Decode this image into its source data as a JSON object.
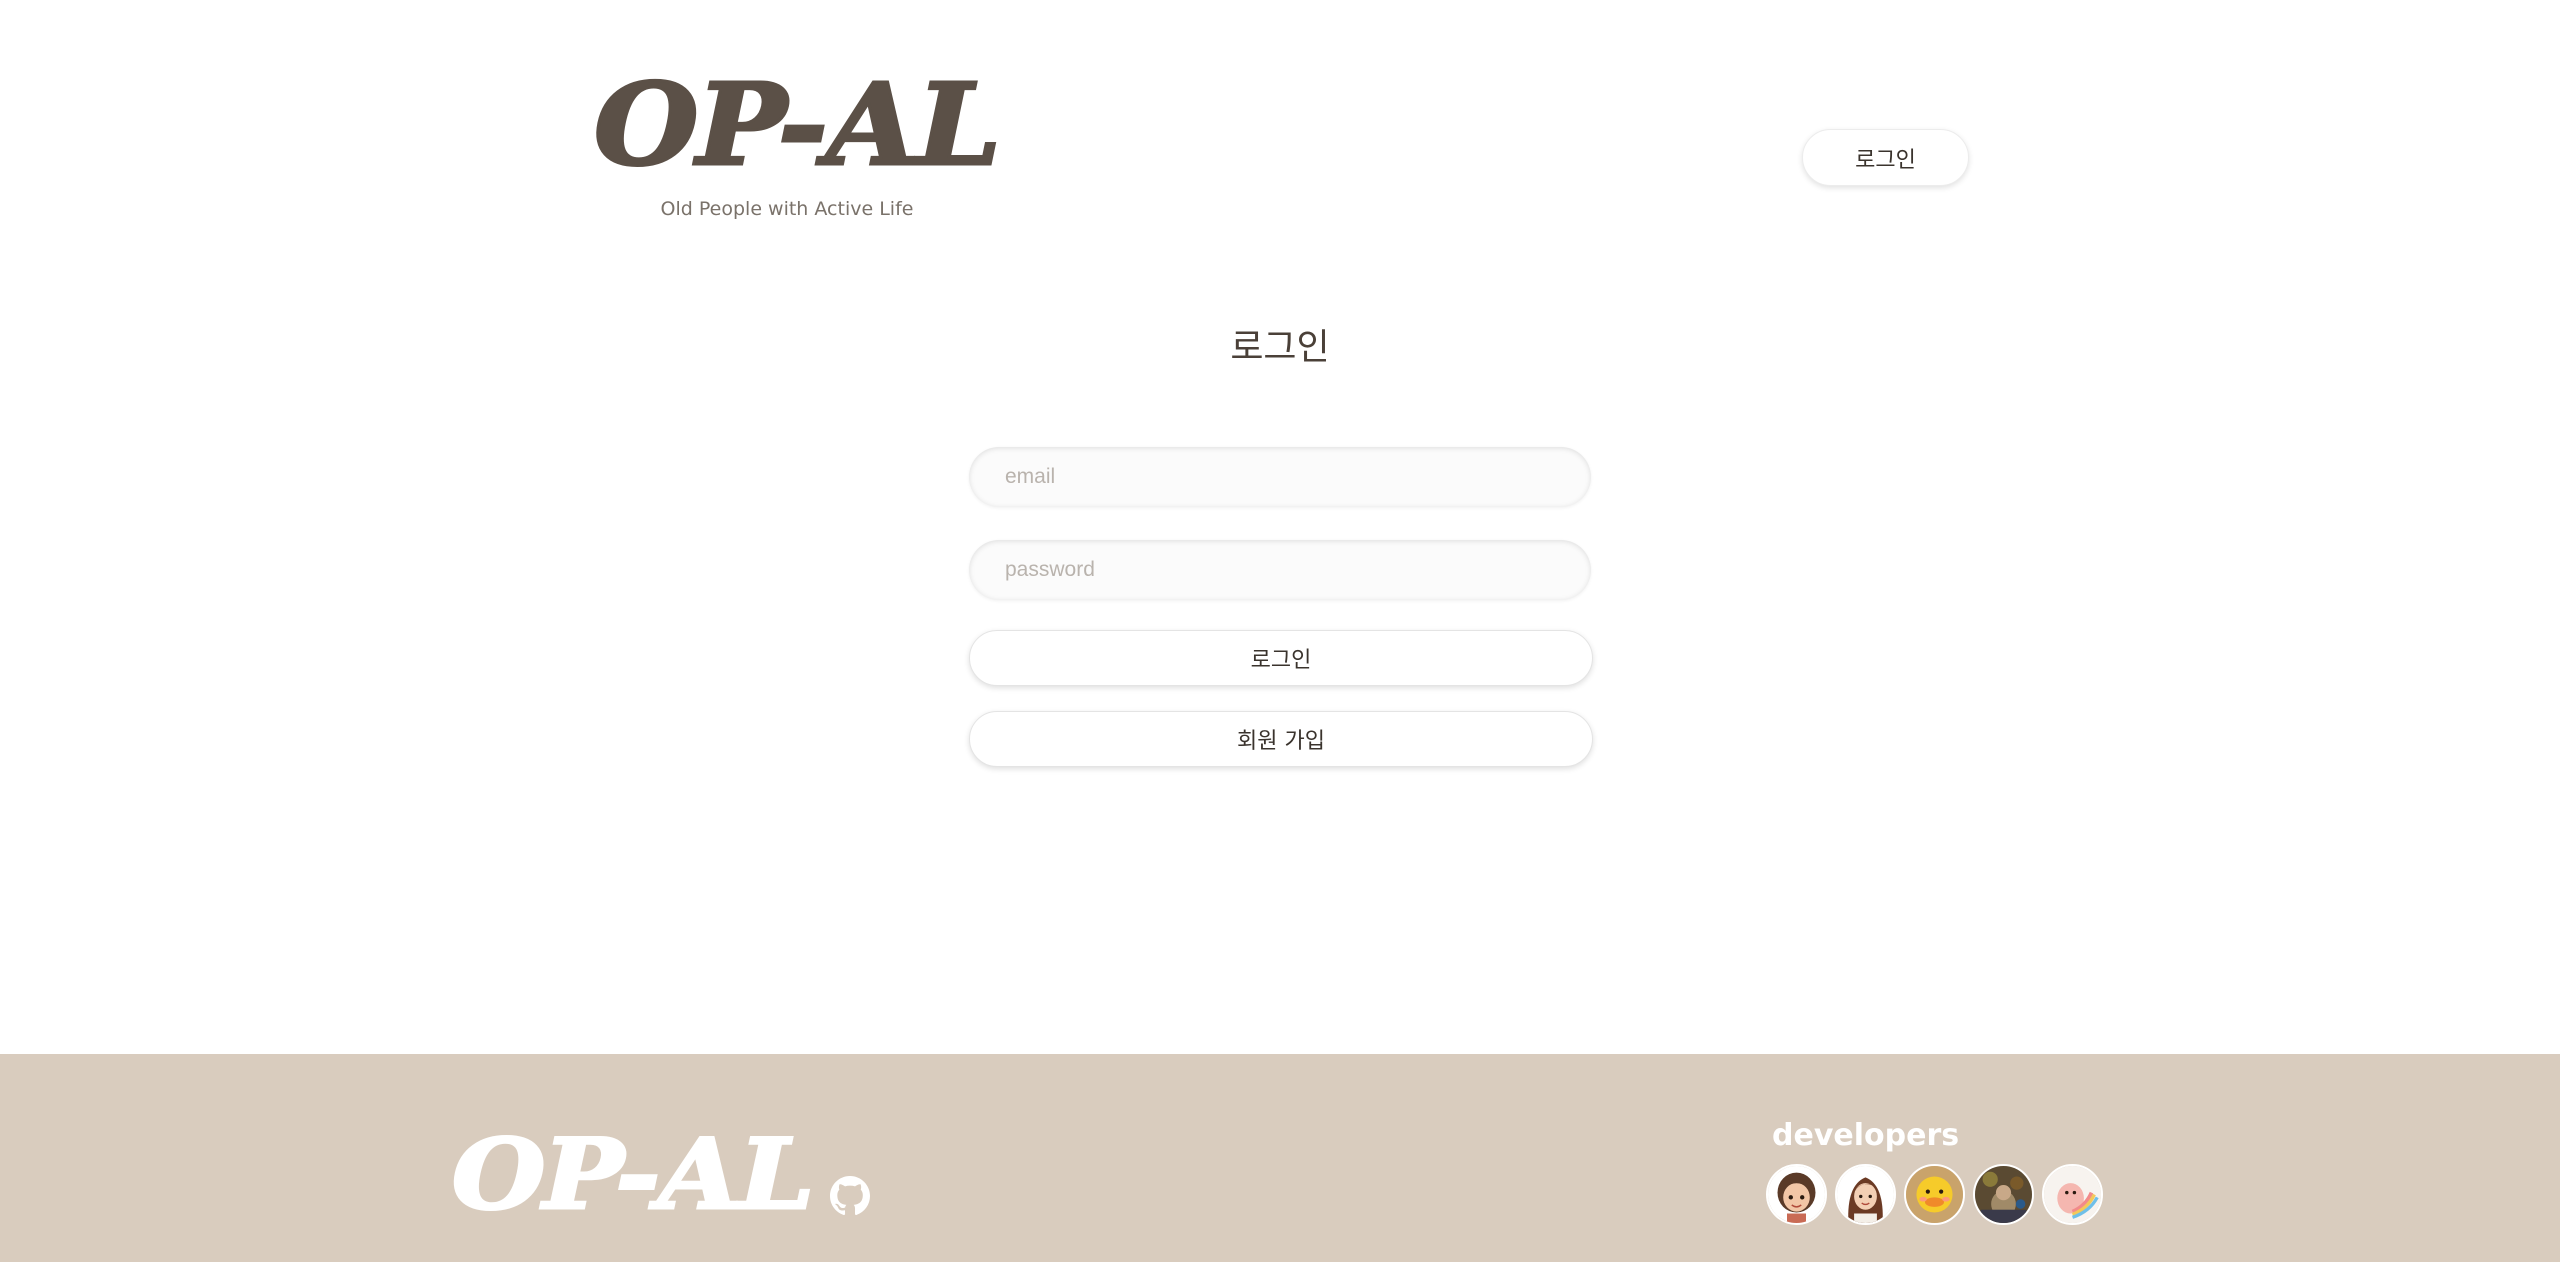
{
  "header": {
    "logo_text": "OP-AL",
    "tagline": "Old People with Active Life",
    "login_label": "로그인"
  },
  "main": {
    "title": "로그인",
    "email_placeholder": "email",
    "password_placeholder": "password",
    "login_button": "로그인",
    "signup_button": "회원 가입"
  },
  "footer": {
    "logo_text": "OP-AL",
    "github_icon": "github-icon",
    "developers_title": "developers",
    "developers": [
      {
        "icon": "developer-avatar-1"
      },
      {
        "icon": "developer-avatar-2"
      },
      {
        "icon": "developer-avatar-3"
      },
      {
        "icon": "developer-avatar-4"
      },
      {
        "icon": "developer-avatar-5"
      }
    ]
  },
  "colors": {
    "brand_dark": "#5b5047",
    "footer_bg": "#d9ccbe",
    "text": "#4a4038"
  }
}
